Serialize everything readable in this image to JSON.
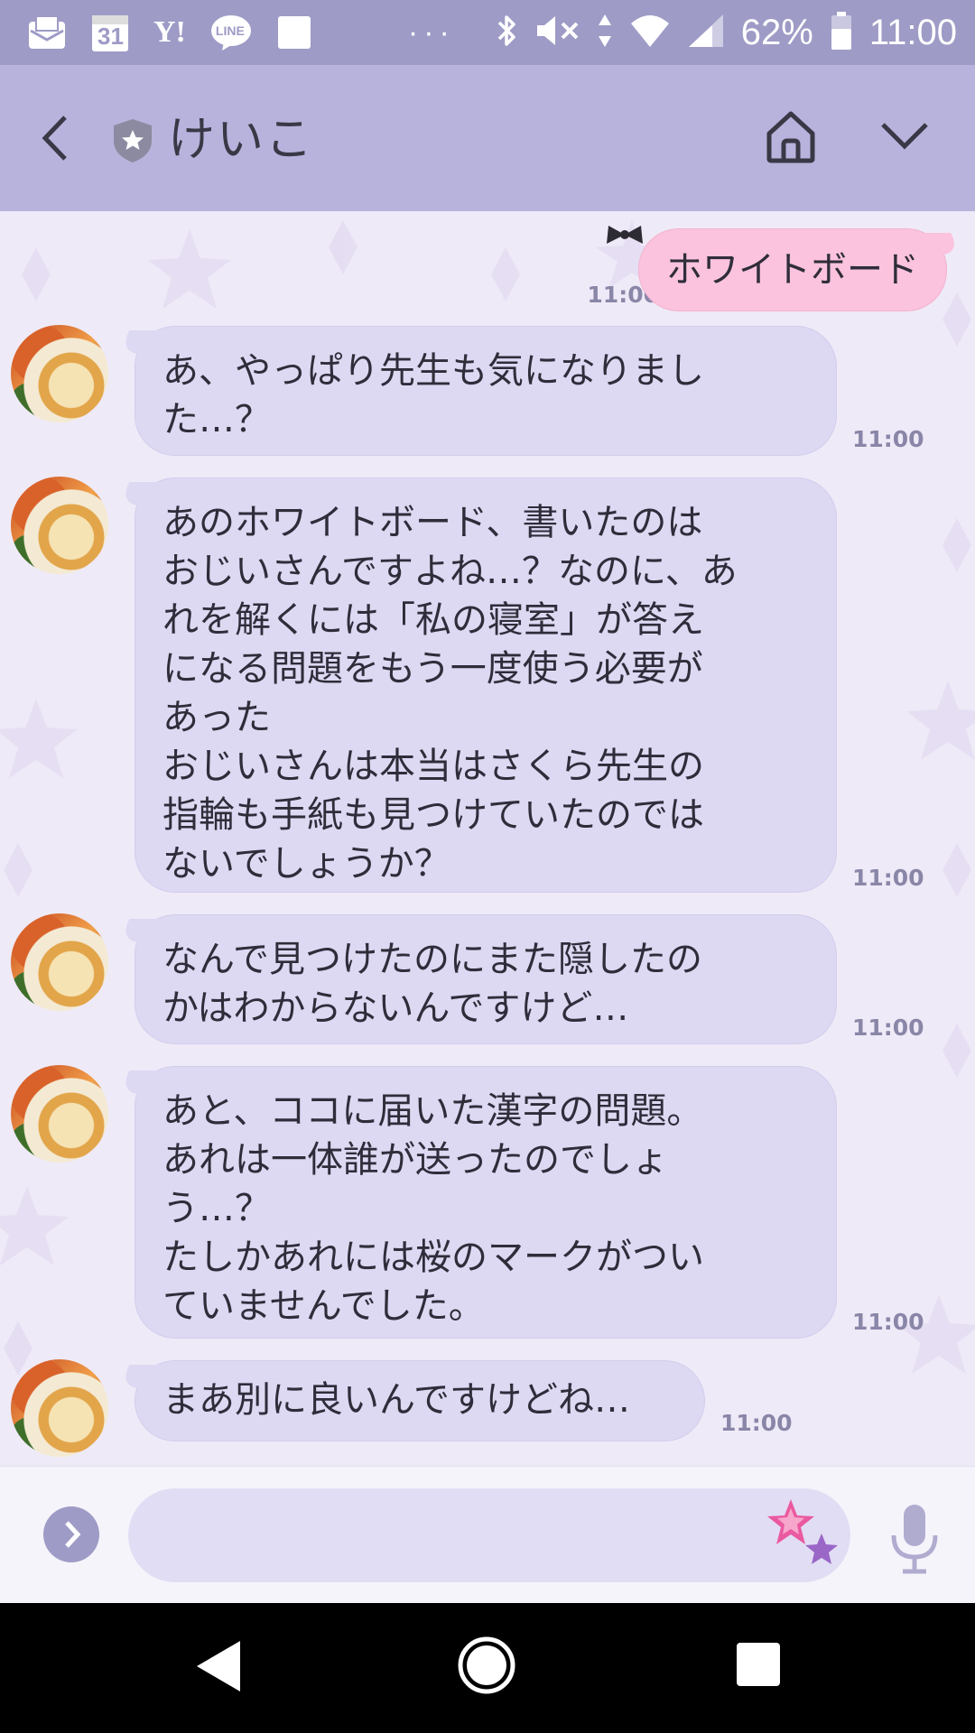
{
  "status_bar": {
    "calendar_day": "31",
    "yahoo_label": "Y!",
    "line_label": "LINE",
    "more": "···",
    "battery": "62%",
    "time": "11:00",
    "icons": [
      "mail-icon",
      "calendar-icon",
      "yahoo-icon",
      "line-icon",
      "square-icon",
      "bluetooth-icon",
      "mute-icon",
      "data-icon",
      "wifi-icon",
      "signal-icon",
      "battery-icon"
    ]
  },
  "header": {
    "name": "けいこ",
    "icons": [
      "back-icon",
      "shield-star-icon",
      "home-icon",
      "chevron-down-icon"
    ]
  },
  "messages": [
    {
      "direction": "out",
      "text": "ホワイトボード",
      "time": "11:00"
    },
    {
      "direction": "in",
      "text": "あ、やっぱり先生も気になりまし\nた…？",
      "time": "11:00"
    },
    {
      "direction": "in",
      "text": "あのホワイトボード、書いたのは\nおじいさんですよね…？なのに、あ\nれを解くには「私の寝室」が答え\nになる問題をもう一度使う必要が\nあった\nおじいさんは本当はさくら先生の\n指輪も手紙も見つけていたのでは\nないでしょうか？",
      "time": "11:00"
    },
    {
      "direction": "in",
      "text": "なんで見つけたのにまた隠したの\nかはわからないんですけど…",
      "time": "11:00"
    },
    {
      "direction": "in",
      "text": "あと、ココに届いた漢字の問題。\nあれは一体誰が送ったのでしょ\nう…？\nたしかあれには桜のマークがつい\nていませんでした。",
      "time": "11:00"
    },
    {
      "direction": "in",
      "text": "まあ別に良いんですけどね…",
      "time": "11:00"
    }
  ],
  "input": {
    "value": "",
    "placeholder": "",
    "icons": [
      "chevron-right-icon",
      "sticker-star-icon",
      "mic-icon"
    ]
  },
  "nav": {
    "icons": [
      "nav-back-icon",
      "nav-home-icon",
      "nav-recent-icon"
    ]
  },
  "colors": {
    "status_bar": "#9e9bc6",
    "header": "#b8b3dc",
    "incoming_bubble": "#ddd9f3",
    "outgoing_bubble": "#fbc3dd",
    "time_text": "#8a86a8"
  }
}
